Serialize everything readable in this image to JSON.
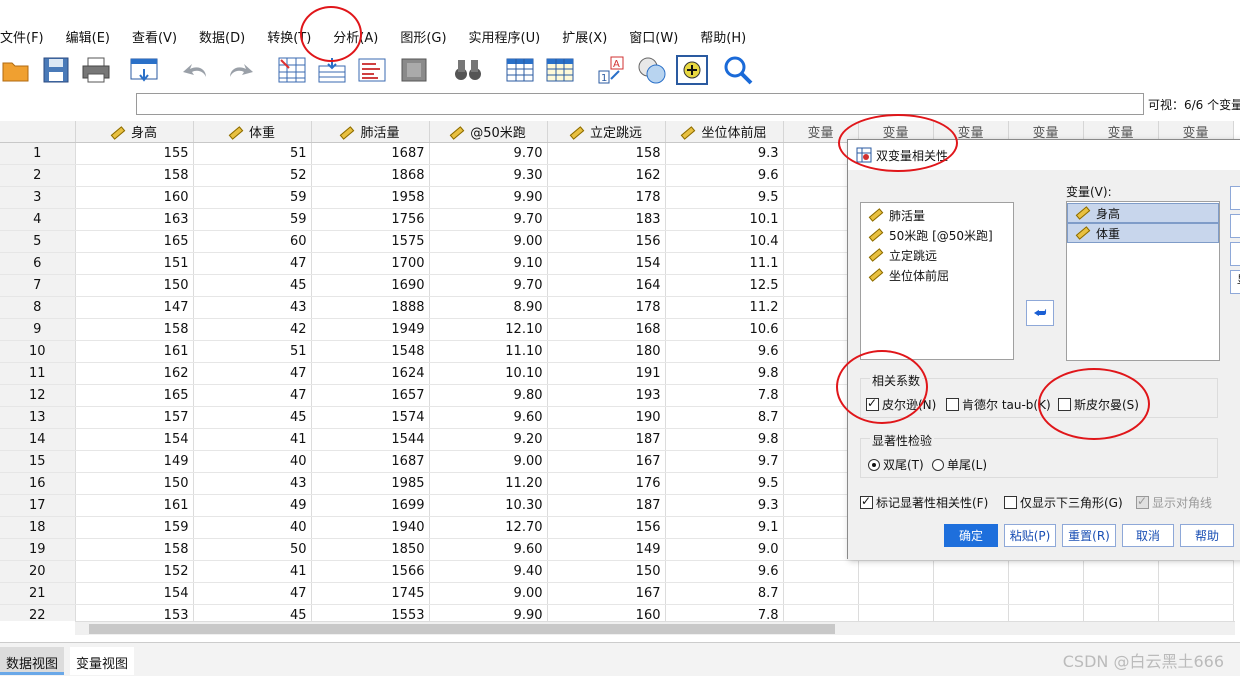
{
  "menu": [
    "文件(F)",
    "编辑(E)",
    "查看(V)",
    "数据(D)",
    "转换(T)",
    "分析(A)",
    "图形(G)",
    "实用程序(U)",
    "扩展(X)",
    "窗口(W)",
    "帮助(H)"
  ],
  "visible_label": "可视：6/6 个变量",
  "columns": [
    "身高",
    "体重",
    "肺活量",
    "@50米跑",
    "立定跳远",
    "坐位体前屈"
  ],
  "var_label": "变量",
  "rows": [
    [
      "1",
      "155",
      "51",
      "1687",
      "9.70",
      "158",
      "9.3"
    ],
    [
      "2",
      "158",
      "52",
      "1868",
      "9.30",
      "162",
      "9.6"
    ],
    [
      "3",
      "160",
      "59",
      "1958",
      "9.90",
      "178",
      "9.5"
    ],
    [
      "4",
      "163",
      "59",
      "1756",
      "9.70",
      "183",
      "10.1"
    ],
    [
      "5",
      "165",
      "60",
      "1575",
      "9.00",
      "156",
      "10.4"
    ],
    [
      "6",
      "151",
      "47",
      "1700",
      "9.10",
      "154",
      "11.1"
    ],
    [
      "7",
      "150",
      "45",
      "1690",
      "9.70",
      "164",
      "12.5"
    ],
    [
      "8",
      "147",
      "43",
      "1888",
      "8.90",
      "178",
      "11.2"
    ],
    [
      "9",
      "158",
      "42",
      "1949",
      "12.10",
      "168",
      "10.6"
    ],
    [
      "10",
      "161",
      "51",
      "1548",
      "11.10",
      "180",
      "9.6"
    ],
    [
      "11",
      "162",
      "47",
      "1624",
      "10.10",
      "191",
      "9.8"
    ],
    [
      "12",
      "165",
      "47",
      "1657",
      "9.80",
      "193",
      "7.8"
    ],
    [
      "13",
      "157",
      "45",
      "1574",
      "9.60",
      "190",
      "8.7"
    ],
    [
      "14",
      "154",
      "41",
      "1544",
      "9.20",
      "187",
      "9.8"
    ],
    [
      "15",
      "149",
      "40",
      "1687",
      "9.00",
      "167",
      "9.7"
    ],
    [
      "16",
      "150",
      "43",
      "1985",
      "11.20",
      "176",
      "9.5"
    ],
    [
      "17",
      "161",
      "49",
      "1699",
      "10.30",
      "187",
      "9.3"
    ],
    [
      "18",
      "159",
      "40",
      "1940",
      "12.70",
      "156",
      "9.1"
    ],
    [
      "19",
      "158",
      "50",
      "1850",
      "9.60",
      "149",
      "9.0"
    ],
    [
      "20",
      "152",
      "41",
      "1566",
      "9.40",
      "150",
      "9.6"
    ],
    [
      "21",
      "154",
      "47",
      "1745",
      "9.00",
      "167",
      "8.7"
    ],
    [
      "22",
      "153",
      "45",
      "1553",
      "9.90",
      "160",
      "7.8"
    ]
  ],
  "tabs": [
    "数据视图",
    "变量视图"
  ],
  "watermark": "CSDN @白云黑土666",
  "dialog": {
    "title": "双变量相关性",
    "source_vars": [
      "肺活量",
      "50米跑 [@50米跑]",
      "立定跳远",
      "坐位体前屈"
    ],
    "target_label": "变量(V):",
    "target_vars": [
      "身高",
      "体重"
    ],
    "corr_group": "相关系数",
    "pearson": "皮尔逊(N)",
    "kendall": "肯德尔 tau-b(K)",
    "spearman": "斯皮尔曼(S)",
    "sig_group": "显著性检验",
    "two_tailed": "双尾(T)",
    "one_tailed": "单尾(L)",
    "flag_sig": "标记显著性相关性(F)",
    "lower_tri": "仅显示下三角形(G)",
    "show_diag": "显示对角线",
    "buttons": {
      "ok": "确定",
      "paste": "粘贴(P)",
      "reset": "重置(R)",
      "cancel": "取消",
      "help": "帮助"
    },
    "side_partial": "显"
  },
  "colors": {
    "accent": "#1e6fdc",
    "annotation": "#e0161a"
  }
}
